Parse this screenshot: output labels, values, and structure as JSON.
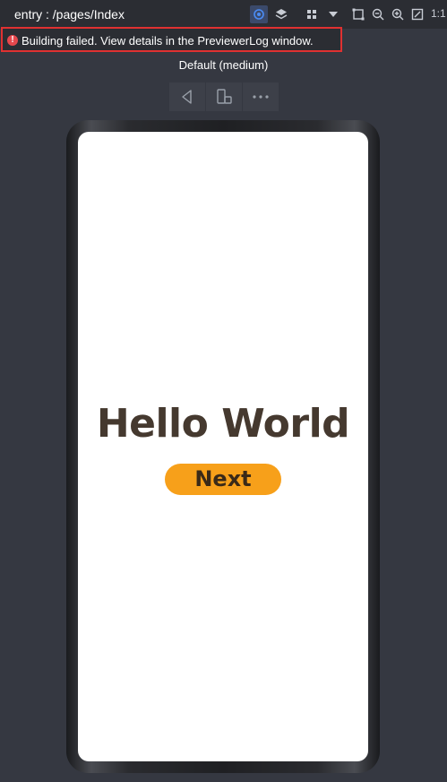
{
  "toolbar": {
    "title": "entry : /pages/Index",
    "ratio_label": "1:1",
    "icons": [
      "inspector-icon",
      "layers-icon",
      "components-icon",
      "dropdown-icon",
      "frame-icon",
      "zoom-out-icon",
      "zoom-in-icon",
      "fit-icon"
    ]
  },
  "error": {
    "message": "Building failed. View details in the PreviewerLog window.",
    "color": "#e03131"
  },
  "device": {
    "label": "Default (medium)",
    "controls": [
      "back-icon",
      "rotate-icon",
      "more-icon"
    ]
  },
  "screen": {
    "title": "Hello World",
    "button_label": "Next",
    "button_color": "#f7a01a",
    "text_color": "#45392f"
  }
}
